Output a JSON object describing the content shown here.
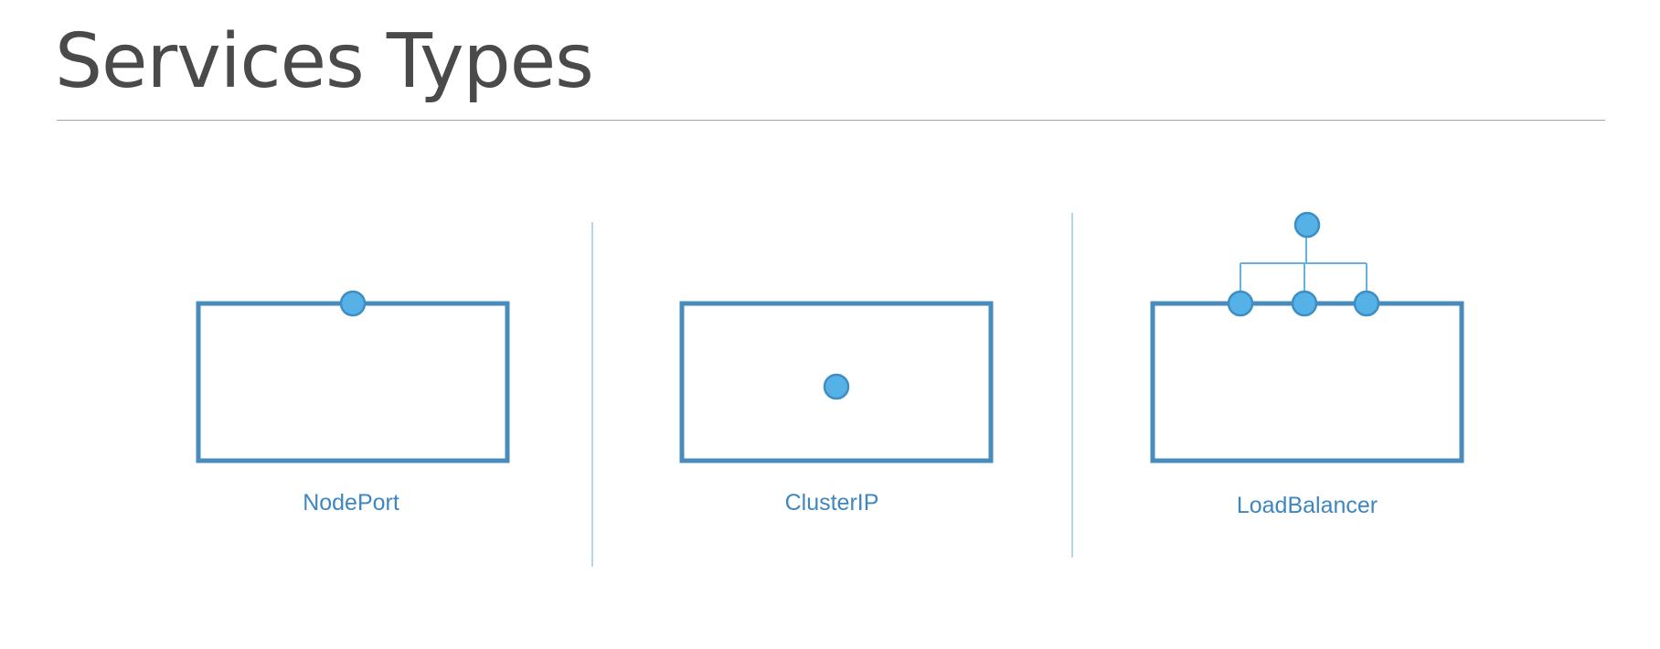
{
  "title": "Services Types",
  "colors": {
    "title_text": "#4a4a4a",
    "box_stroke": "#4a8bbd",
    "port_fill": "#56b1e6",
    "label_text": "#3e86bf",
    "divider": "#9fcbe8"
  },
  "service_types": [
    {
      "label": "NodePort"
    },
    {
      "label": "ClusterIP"
    },
    {
      "label": "LoadBalancer"
    }
  ]
}
